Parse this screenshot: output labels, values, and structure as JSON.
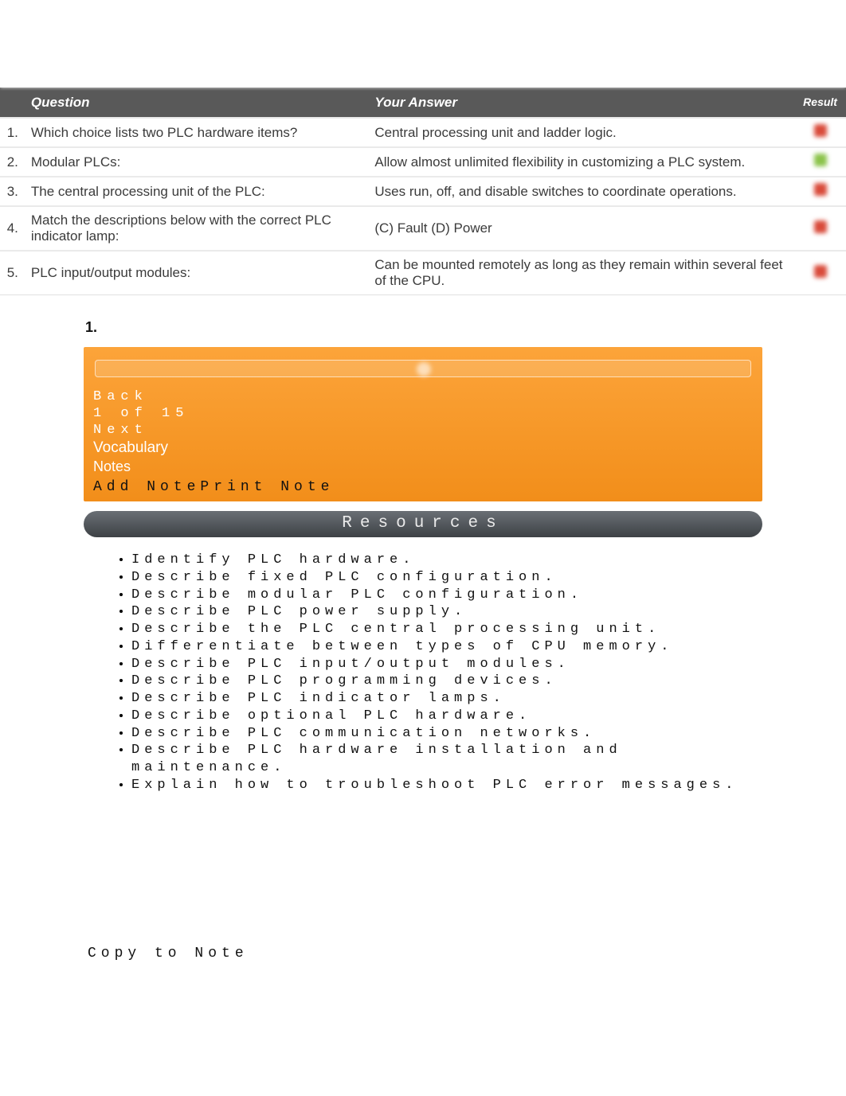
{
  "table": {
    "headers": {
      "question": "Question",
      "answer": "Your Answer",
      "result": "Result"
    },
    "rows": [
      {
        "num": "1.",
        "question": "Which choice lists two PLC hardware items?",
        "answer": "Central processing unit and ladder logic.",
        "result": "red"
      },
      {
        "num": "2.",
        "question": "Modular PLCs:",
        "answer": "Allow almost unlimited flexibility in customizing a PLC system.",
        "result": "green"
      },
      {
        "num": "3.",
        "question": "The central processing unit of the PLC:",
        "answer": "Uses run, off, and disable switches to coordinate operations.",
        "result": "red"
      },
      {
        "num": "4.",
        "question": "Match the descriptions below with the correct PLC indicator lamp:",
        "answer": "(C) Fault (D) Power",
        "result": "red"
      },
      {
        "num": "5.",
        "question": "PLC input/output modules:",
        "answer": "Can be mounted remotely as long as they remain within several feet of the CPU.",
        "result": "red"
      }
    ]
  },
  "panel": {
    "one_label": "1.",
    "back": "Back",
    "pager": "1 of 15",
    "next": "Next",
    "vocab": "Vocabulary",
    "notes": "Notes",
    "add_note": "Add Note",
    "print_note": "Print Note"
  },
  "resources_label": "Resources",
  "objectives": [
    "Identify PLC hardware.",
    "Describe fixed PLC configuration.",
    "Describe modular PLC configuration.",
    "Describe PLC power supply.",
    "Describe the PLC central processing unit.",
    "Differentiate between types of CPU memory.",
    "Describe PLC input/output modules.",
    "Describe PLC programming devices.",
    "Describe PLC indicator lamps.",
    "Describe optional PLC hardware.",
    "Describe PLC communication networks.",
    "Describe PLC hardware installation and maintenance.",
    "Explain how to troubleshoot PLC error messages."
  ],
  "copy_to_note": "Copy to Note"
}
